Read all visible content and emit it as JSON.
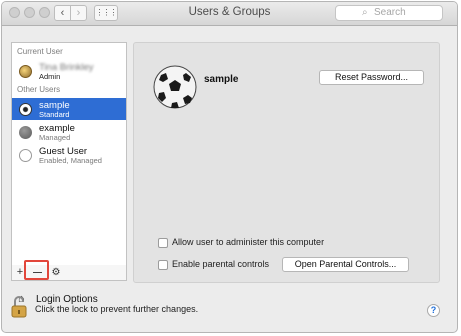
{
  "window": {
    "title": "Users & Groups",
    "search": {
      "placeholder": "Search",
      "icon": "magnifier-icon"
    },
    "nav": {
      "back": "‹",
      "forward": "›",
      "grid": "⋮⋮⋮"
    }
  },
  "sidebar": {
    "current_user_heading": "Current User",
    "current_user": {
      "name": "Tina Brinkley",
      "role": "Admin"
    },
    "other_users_heading": "Other Users",
    "users": [
      {
        "name": "sample",
        "role": "Standard",
        "selected": true
      },
      {
        "name": "example",
        "role": "Managed"
      },
      {
        "name": "Guest User",
        "role": "Enabled, Managed"
      }
    ],
    "login_options_label": "Login Options",
    "bottom": {
      "add": "+",
      "remove": "—",
      "gear": "⚙"
    }
  },
  "detail": {
    "username": "sample",
    "reset_password_label": "Reset Password...",
    "allow_admin_label": "Allow user to administer this computer",
    "allow_admin_checked": false,
    "parental_controls_label": "Enable parental controls",
    "parental_controls_checked": false,
    "open_parental_label": "Open Parental Controls..."
  },
  "footer": {
    "lock_text": "Click the lock to prevent further changes.",
    "help_label": "?"
  },
  "colors": {
    "selection": "#2e6dd4",
    "highlight": "#e2463b",
    "help": "#1e6fd9"
  }
}
